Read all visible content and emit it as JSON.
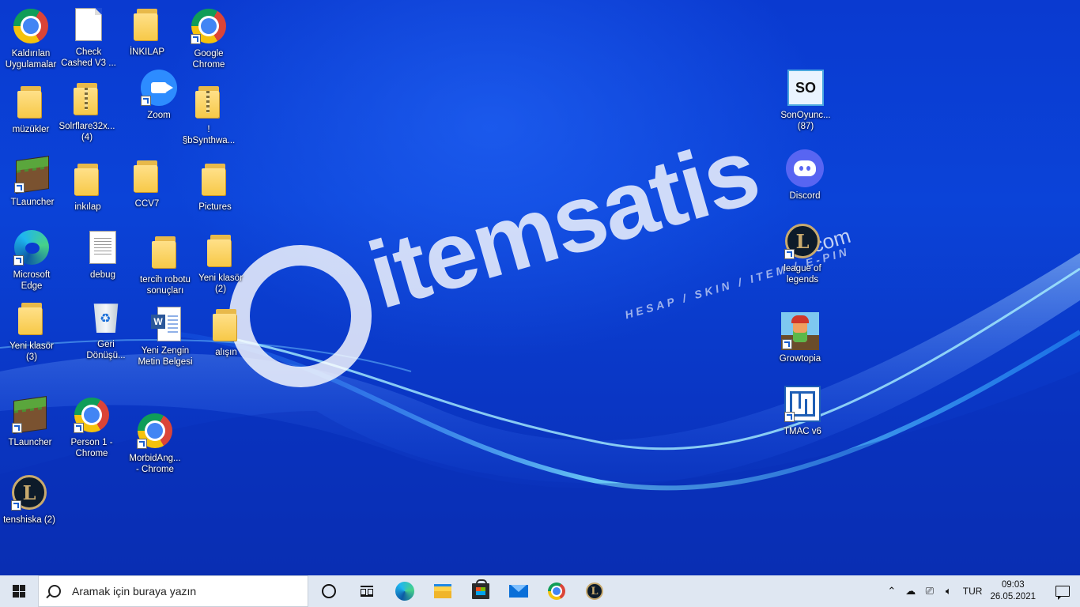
{
  "desktop": {
    "icons": [
      {
        "label": "Kaldırılan\nUygulamalar",
        "icon": "chrome-icon"
      },
      {
        "label": "Check\nCashed V3 ...",
        "icon": "document-icon"
      },
      {
        "label": "İNKILAP",
        "icon": "folder-icon"
      },
      {
        "label": "Google\nChrome",
        "icon": "chrome-icon"
      },
      {
        "label": "müzükler",
        "icon": "folder-icon"
      },
      {
        "label": "Solrflare32x...\n(4)",
        "icon": "zip-folder-icon"
      },
      {
        "label": "Zoom",
        "icon": "zoom-icon"
      },
      {
        "label": "!\n§bSynthwa...",
        "icon": "zip-folder-icon"
      },
      {
        "label": "TLauncher",
        "icon": "minecraft-icon"
      },
      {
        "label": "inkılap",
        "icon": "folder-icon"
      },
      {
        "label": "CCV7",
        "icon": "folder-icon"
      },
      {
        "label": "Pictures",
        "icon": "folder-icon"
      },
      {
        "label": "Microsoft\nEdge",
        "icon": "edge-icon"
      },
      {
        "label": "debug",
        "icon": "text-file-icon"
      },
      {
        "label": "tercih robotu\nsonuçları",
        "icon": "folder-icon"
      },
      {
        "label": "Yeni klasör\n(2)",
        "icon": "folder-icon"
      },
      {
        "label": "Yeni klasör\n(3)",
        "icon": "folder-icon"
      },
      {
        "label": "Geri\nDönüşü...",
        "icon": "recycle-bin-icon"
      },
      {
        "label": "Yeni Zengin\nMetin Belgesi",
        "icon": "word-document-icon"
      },
      {
        "label": "alışın",
        "icon": "folder-icon"
      },
      {
        "label": "TLauncher",
        "icon": "minecraft-icon"
      },
      {
        "label": "Person 1 -\nChrome",
        "icon": "chrome-icon"
      },
      {
        "label": "MorbidAng...\n- Chrome",
        "icon": "chrome-icon"
      },
      {
        "label": "tenshiska (2)",
        "icon": "league-icon"
      },
      {
        "label": "SonOyunc...\n(87)",
        "icon": "sonoyuncu-icon"
      },
      {
        "label": "Discord",
        "icon": "discord-icon"
      },
      {
        "label": "league of\nlegends",
        "icon": "league-icon"
      },
      {
        "label": "Growtopia",
        "icon": "growtopia-icon"
      },
      {
        "label": "TMAC v6",
        "icon": "tmac-icon"
      }
    ],
    "watermark": {
      "brand": "itemsatis",
      "tld": ".com",
      "tagline": "HESAP / SKIN / ITEM / E-PIN"
    }
  },
  "taskbar": {
    "search_placeholder": "Aramak için buraya yazın",
    "pinned": [
      "cortana-icon",
      "task-view-icon",
      "edge-icon",
      "file-explorer-icon",
      "store-icon",
      "mail-icon",
      "chrome-icon",
      "league-icon"
    ],
    "tray": {
      "language": "TUR",
      "time": "09:03",
      "date": "26.05.2021"
    }
  }
}
